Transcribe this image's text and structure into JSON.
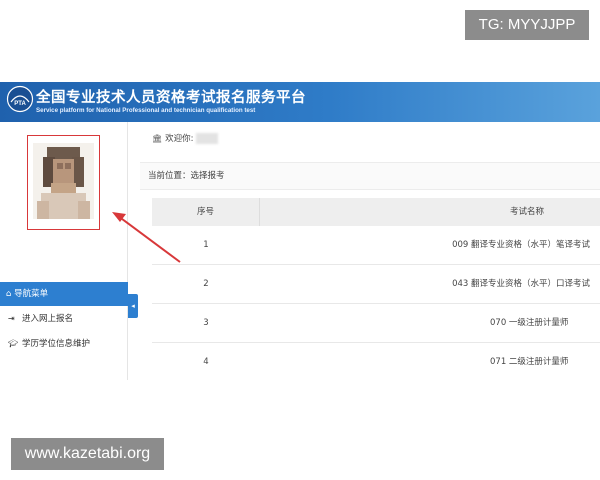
{
  "watermarks": {
    "top": "TG: MYYJJPP",
    "bottom": "www.kazetabi.org"
  },
  "header": {
    "logo_text": "PTA",
    "title": "全国专业技术人员资格考试报名服务平台",
    "subtitle": "Service platform for National Professional and technician qualification test"
  },
  "sidebar": {
    "nav_header": "导航菜单",
    "items": [
      {
        "label": "进入网上报名",
        "icon": "sign-in-icon"
      },
      {
        "label": "学历学位信息维护",
        "icon": "graduation-cap-icon"
      }
    ],
    "collapse_label": "◂"
  },
  "main": {
    "welcome": "欢迎你:",
    "breadcrumb": "当前位置：选择报考",
    "table": {
      "headers": [
        "序号",
        "考试名称"
      ],
      "rows": [
        {
          "no": "1",
          "name": "009 翻译专业资格（水平）笔译考试"
        },
        {
          "no": "2",
          "name": "043 翻译专业资格（水平）口译考试"
        },
        {
          "no": "3",
          "name": "070 一级注册计量师"
        },
        {
          "no": "4",
          "name": "071 二级注册计量师"
        }
      ]
    }
  },
  "colors": {
    "header_blue": "#1f61ad",
    "nav_blue": "#2d7fd0",
    "highlight_red": "#d8383a",
    "watermark_gray": "#8c8c8c"
  }
}
